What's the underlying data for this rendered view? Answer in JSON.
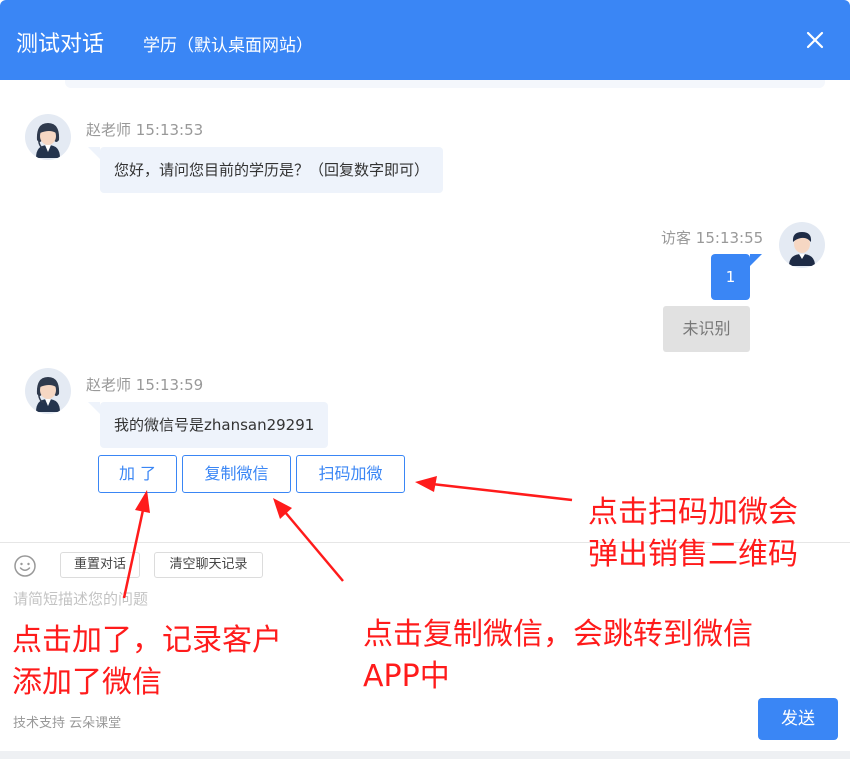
{
  "header": {
    "title": "测试对话",
    "subtitle": "学历（默认桌面网站）"
  },
  "messages": [
    {
      "sender": "赵老师",
      "time": "15:13:53",
      "text": "您好，请问您目前的学历是？（回复数字即可）"
    },
    {
      "sender": "访客",
      "time": "15:13:55",
      "text": "1",
      "status": "未识别"
    },
    {
      "sender": "赵老师",
      "time": "15:13:59",
      "text": "我的微信号是zhansan29291"
    }
  ],
  "quick_buttons": [
    "加 了",
    "复制微信",
    "扫码加微"
  ],
  "toolbar": {
    "reset_label": "重置对话",
    "clear_label": "清空聊天记录"
  },
  "input": {
    "placeholder": "请简短描述您的问题"
  },
  "footer": {
    "support": "技术支持 云朵课堂",
    "send_label": "发送"
  },
  "annotations": [
    "点击扫码加微会\n弹出销售二维码",
    "点击复制微信，会跳转到微信\nAPP中",
    "点击加了，记录客户\n添加了微信"
  ],
  "colors": {
    "primary": "#3a86f5",
    "annotation": "#ff1b1b",
    "bubble_bg": "#eef3fb"
  }
}
